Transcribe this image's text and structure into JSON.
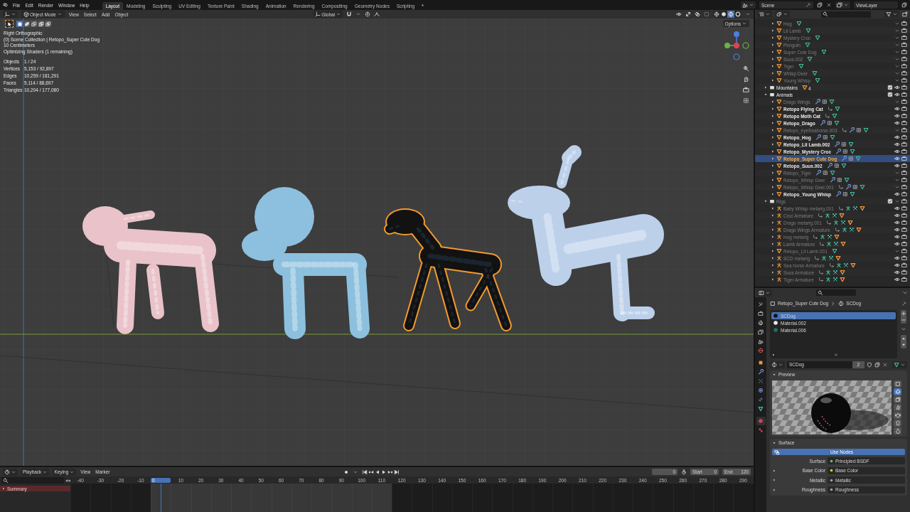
{
  "topbar": {
    "menus": [
      "File",
      "Edit",
      "Render",
      "Window",
      "Help"
    ],
    "workspaces": [
      {
        "label": "Layout",
        "selected": true
      },
      {
        "label": "Modeling",
        "selected": false
      },
      {
        "label": "Sculpting",
        "selected": false
      },
      {
        "label": "UV Editing",
        "selected": false
      },
      {
        "label": "Texture Paint",
        "selected": false
      },
      {
        "label": "Shading",
        "selected": false
      },
      {
        "label": "Animation",
        "selected": false
      },
      {
        "label": "Rendering",
        "selected": false
      },
      {
        "label": "Compositing",
        "selected": false
      },
      {
        "label": "Geometry Nodes",
        "selected": false
      },
      {
        "label": "Scripting",
        "selected": false
      }
    ],
    "add_workspace": "+",
    "scene": "Scene",
    "view_layer": "ViewLayer"
  },
  "viewport": {
    "mode": "Object Mode",
    "menus": [
      "View",
      "Select",
      "Add",
      "Object"
    ],
    "orientation": "Global",
    "shading": [
      {
        "kind": "wireframe",
        "selected": false
      },
      {
        "kind": "solid",
        "selected": false
      },
      {
        "kind": "material",
        "selected": true
      },
      {
        "kind": "rendered",
        "selected": false
      }
    ],
    "select_modes": [
      {
        "kind": "set",
        "selected": true
      },
      {
        "kind": "extend",
        "selected": false
      },
      {
        "kind": "subtract",
        "selected": false
      },
      {
        "kind": "difference",
        "selected": false
      },
      {
        "kind": "intersect",
        "selected": false
      }
    ],
    "options": "Options",
    "info": [
      "Right Orthographic",
      "(0) Scene Collection | Retopo_Super Cute Dog",
      "10 Centimeters",
      "Optimizing Shaders (1 remaining)"
    ],
    "stats": [
      {
        "label": "Objects",
        "value": "1 / 24"
      },
      {
        "label": "Vertices",
        "value": "5,153 / 92,897"
      },
      {
        "label": "Edges",
        "value": "10,259 / 181,291"
      },
      {
        "label": "Faces",
        "value": "5,114 / 88,697"
      },
      {
        "label": "Triangles",
        "value": "10,204 / 177,080"
      }
    ],
    "models": [
      {
        "kind": "lamb",
        "selected": false
      },
      {
        "kind": "deer",
        "selected": false
      },
      {
        "kind": "dog",
        "selected": true
      },
      {
        "kind": "seahorse",
        "selected": false
      }
    ]
  },
  "outliner": {
    "partial_items": [
      {
        "kind": "mesh-object",
        "name": "Hog",
        "visible": false,
        "selected": false,
        "expanded": false,
        "icons": [
          {
            "kind": "mesh"
          }
        ]
      },
      {
        "kind": "mesh-object",
        "name": "Lil Lamb",
        "visible": false,
        "selected": false,
        "expanded": false,
        "icons": [
          {
            "kind": "mesh"
          }
        ]
      },
      {
        "kind": "mesh-object",
        "name": "Mystery Croc",
        "visible": false,
        "selected": false,
        "expanded": false,
        "icons": [
          {
            "kind": "mesh"
          }
        ]
      },
      {
        "kind": "mesh-object",
        "name": "Penguin",
        "visible": false,
        "selected": false,
        "expanded": false,
        "icons": [
          {
            "kind": "mesh"
          }
        ]
      },
      {
        "kind": "mesh-object",
        "name": "Super Cute Dog",
        "visible": false,
        "selected": false,
        "expanded": false,
        "icons": [
          {
            "kind": "mesh"
          }
        ]
      },
      {
        "kind": "mesh-object",
        "name": "Suus.002",
        "visible": false,
        "selected": false,
        "expanded": false,
        "icons": [
          {
            "kind": "mesh"
          }
        ]
      },
      {
        "kind": "mesh-object",
        "name": "Tiger",
        "visible": false,
        "selected": false,
        "expanded": false,
        "icons": [
          {
            "kind": "mesh"
          }
        ]
      },
      {
        "kind": "mesh-object",
        "name": "Whisp Deer",
        "visible": false,
        "selected": false,
        "expanded": false,
        "icons": [
          {
            "kind": "mesh"
          }
        ]
      },
      {
        "kind": "mesh-object",
        "name": "Young Whisp",
        "visible": false,
        "selected": false,
        "expanded": false,
        "icons": [
          {
            "kind": "mesh"
          }
        ]
      }
    ],
    "items": [
      {
        "kind": "collection",
        "name": "Mountains",
        "visible": true,
        "checked": true,
        "selected": false,
        "expanded": false,
        "icons": [
          {
            "kind": "mesh-object"
          }
        ],
        "count": "4"
      },
      {
        "kind": "collection",
        "name": "Animals",
        "visible": true,
        "checked": true,
        "selected": false,
        "expanded": true,
        "children": [
          {
            "kind": "mesh-object",
            "name": "Drago Wings",
            "visible": false,
            "selected": false,
            "expanded": false,
            "icons": [
              {
                "kind": "wrench"
              },
              {
                "kind": "grid"
              },
              {
                "kind": "mesh"
              }
            ]
          },
          {
            "kind": "mesh-object",
            "name": "Retopo Flying Cat",
            "visible": true,
            "selected": false,
            "expanded": false,
            "icons": [
              {
                "kind": "hook"
              },
              {
                "kind": "mesh"
              }
            ]
          },
          {
            "kind": "mesh-object",
            "name": "Retopo Moth Cat",
            "visible": true,
            "selected": false,
            "expanded": false,
            "icons": [
              {
                "kind": "hook"
              },
              {
                "kind": "mesh"
              }
            ]
          },
          {
            "kind": "mesh-object",
            "name": "Retopo_Drago",
            "visible": true,
            "selected": false,
            "expanded": false,
            "icons": [
              {
                "kind": "wrench"
              },
              {
                "kind": "grid"
              },
              {
                "kind": "mesh"
              }
            ]
          },
          {
            "kind": "mesh-object",
            "name": "Retopo_eyeSeahorse.003",
            "visible": false,
            "selected": false,
            "expanded": false,
            "icons": [
              {
                "kind": "hook"
              },
              {
                "kind": "wrench"
              },
              {
                "kind": "grid"
              },
              {
                "kind": "mesh"
              }
            ]
          },
          {
            "kind": "mesh-object",
            "name": "Retopo_Hog",
            "visible": true,
            "selected": false,
            "expanded": false,
            "icons": [
              {
                "kind": "wrench"
              },
              {
                "kind": "grid"
              },
              {
                "kind": "mesh"
              }
            ]
          },
          {
            "kind": "mesh-object",
            "name": "Retopo_Lil Lamb.002",
            "visible": true,
            "selected": false,
            "expanded": false,
            "icons": [
              {
                "kind": "wrench"
              },
              {
                "kind": "grid"
              },
              {
                "kind": "mesh"
              }
            ]
          },
          {
            "kind": "mesh-object",
            "name": "Retopo_Mystery Croc",
            "visible": true,
            "selected": false,
            "expanded": false,
            "icons": [
              {
                "kind": "wrench"
              },
              {
                "kind": "grid"
              },
              {
                "kind": "mesh"
              }
            ]
          },
          {
            "kind": "mesh-object",
            "name": "Retopo_Super Cute Dog",
            "visible": true,
            "selected": true,
            "expanded": false,
            "icons": [
              {
                "kind": "wrench"
              },
              {
                "kind": "grid"
              },
              {
                "kind": "mesh"
              }
            ]
          },
          {
            "kind": "mesh-object",
            "name": "Retopo_Suus.002",
            "visible": true,
            "selected": false,
            "expanded": false,
            "icons": [
              {
                "kind": "wrench"
              },
              {
                "kind": "grid"
              },
              {
                "kind": "mesh"
              }
            ]
          },
          {
            "kind": "mesh-object",
            "name": "Retopo_Tiger",
            "visible": false,
            "selected": false,
            "expanded": false,
            "icons": [
              {
                "kind": "wrench"
              },
              {
                "kind": "grid"
              },
              {
                "kind": "mesh"
              }
            ]
          },
          {
            "kind": "mesh-object",
            "name": "Retopo_Whisp Deer",
            "visible": false,
            "selected": false,
            "expanded": false,
            "icons": [
              {
                "kind": "wrench"
              },
              {
                "kind": "grid"
              },
              {
                "kind": "mesh"
              }
            ]
          },
          {
            "kind": "mesh-object",
            "name": "Retopo_Whisp Deer.001",
            "visible": false,
            "selected": false,
            "expanded": false,
            "icons": [
              {
                "kind": "hook"
              },
              {
                "kind": "wrench"
              },
              {
                "kind": "grid"
              },
              {
                "kind": "mesh"
              }
            ]
          },
          {
            "kind": "mesh-object",
            "name": "Retopo_Young Whisp",
            "visible": true,
            "selected": false,
            "expanded": false,
            "icons": [
              {
                "kind": "wrench"
              },
              {
                "kind": "grid"
              },
              {
                "kind": "mesh"
              }
            ]
          }
        ]
      },
      {
        "kind": "collection",
        "name": "Rigs",
        "visible": false,
        "checked": true,
        "selected": false,
        "expanded": true,
        "children": [
          {
            "kind": "armature-object",
            "name": "Baby Whisp metarig.001",
            "visible": true,
            "selected": false,
            "expanded": false,
            "icons": [
              {
                "kind": "hook"
              },
              {
                "kind": "armature-data"
              },
              {
                "kind": "pose"
              },
              {
                "kind": "mesh-object"
              }
            ]
          },
          {
            "kind": "armature-object",
            "name": "Croc Armature",
            "visible": true,
            "selected": false,
            "expanded": false,
            "icons": [
              {
                "kind": "hook"
              },
              {
                "kind": "armature-data"
              },
              {
                "kind": "pose"
              },
              {
                "kind": "mesh-object"
              }
            ]
          },
          {
            "kind": "armature-object",
            "name": "Drago metarig.001",
            "visible": true,
            "selected": false,
            "expanded": false,
            "icons": [
              {
                "kind": "hook"
              },
              {
                "kind": "armature-data"
              },
              {
                "kind": "pose"
              },
              {
                "kind": "mesh-object"
              }
            ]
          },
          {
            "kind": "armature-object",
            "name": "Drago Wings Armature",
            "visible": true,
            "selected": false,
            "expanded": false,
            "icons": [
              {
                "kind": "hook"
              },
              {
                "kind": "armature-data"
              },
              {
                "kind": "pose"
              },
              {
                "kind": "mesh-object"
              }
            ]
          },
          {
            "kind": "armature-object",
            "name": "Hog metarig",
            "visible": true,
            "selected": false,
            "expanded": false,
            "icons": [
              {
                "kind": "hook"
              },
              {
                "kind": "armature-data"
              },
              {
                "kind": "pose"
              },
              {
                "kind": "mesh-object"
              }
            ]
          },
          {
            "kind": "armature-object",
            "name": "Lamb Armature",
            "visible": true,
            "selected": false,
            "expanded": false,
            "icons": [
              {
                "kind": "hook"
              },
              {
                "kind": "armature-data"
              },
              {
                "kind": "pose"
              },
              {
                "kind": "mesh-object"
              }
            ]
          },
          {
            "kind": "mesh-object",
            "name": "Retopo_Lil Lamb.001",
            "visible": false,
            "selected": false,
            "expanded": false,
            "icons": [
              {
                "kind": "mesh"
              }
            ]
          },
          {
            "kind": "armature-object",
            "name": "SCD metarig",
            "visible": true,
            "selected": false,
            "expanded": false,
            "icons": [
              {
                "kind": "hook"
              },
              {
                "kind": "armature-data"
              },
              {
                "kind": "pose"
              },
              {
                "kind": "mesh-object"
              }
            ]
          },
          {
            "kind": "armature-object",
            "name": "Sea horse Armature",
            "visible": true,
            "selected": false,
            "expanded": false,
            "icons": [
              {
                "kind": "hook"
              },
              {
                "kind": "armature-data"
              },
              {
                "kind": "pose"
              },
              {
                "kind": "mesh-object"
              }
            ]
          },
          {
            "kind": "armature-object",
            "name": "Suus Armature",
            "visible": true,
            "selected": false,
            "expanded": false,
            "icons": [
              {
                "kind": "hook"
              },
              {
                "kind": "armature-data"
              },
              {
                "kind": "pose"
              },
              {
                "kind": "mesh-object"
              }
            ]
          },
          {
            "kind": "armature-object",
            "name": "Tiger Armature",
            "visible": true,
            "selected": false,
            "expanded": false,
            "icons": [
              {
                "kind": "hook"
              },
              {
                "kind": "armature-data"
              },
              {
                "kind": "pose"
              },
              {
                "kind": "mesh-object"
              }
            ]
          }
        ]
      }
    ]
  },
  "properties": {
    "tabs": [
      {
        "kind": "tool",
        "selected": false
      },
      {
        "kind": "render",
        "selected": false
      },
      {
        "kind": "output",
        "selected": false
      },
      {
        "kind": "view-layer",
        "selected": false
      },
      {
        "kind": "scene",
        "selected": false
      },
      {
        "kind": "world",
        "selected": false
      },
      {
        "kind": "object",
        "selected": false
      },
      {
        "kind": "modifiers",
        "selected": false
      },
      {
        "kind": "particles",
        "selected": false
      },
      {
        "kind": "physics",
        "selected": false
      },
      {
        "kind": "constraints",
        "selected": false
      },
      {
        "kind": "data",
        "selected": false
      },
      {
        "kind": "material",
        "selected": true
      },
      {
        "kind": "texture",
        "selected": false
      }
    ],
    "object": "Retopo_Super Cute Dog",
    "material": "SCDog",
    "slots": [
      {
        "name": "SCDog",
        "selected": true,
        "color": "#101010"
      },
      {
        "name": "Material.002",
        "selected": false,
        "color": "#e8e8e8"
      },
      {
        "name": "Material.006",
        "selected": false,
        "color": "#1f6f6a"
      }
    ],
    "material_field": {
      "name": "SCDog",
      "users": "2"
    },
    "preview": {
      "title": "Preview",
      "expanded": true,
      "shapes": [
        {
          "kind": "plane",
          "selected": false
        },
        {
          "kind": "sphere",
          "selected": true
        },
        {
          "kind": "cube",
          "selected": false
        },
        {
          "kind": "hair",
          "selected": false
        },
        {
          "kind": "monkey",
          "selected": false
        },
        {
          "kind": "cloth",
          "selected": false
        },
        {
          "kind": "fluid",
          "selected": false
        }
      ]
    },
    "surface": {
      "title": "Surface",
      "expanded": true,
      "use_nodes": "Use Nodes",
      "rows": [
        {
          "label": "Surface",
          "value": "Principled BSDF",
          "color": "#5ccc5c",
          "expandable": false
        },
        {
          "label": "Base Color",
          "value": "Base Color",
          "color": "#e8d21a",
          "expandable": true
        },
        {
          "label": "Metallic",
          "value": "Metallic",
          "color": "#a1a1a1",
          "expandable": true
        },
        {
          "label": "Roughness",
          "value": "Roughness",
          "color": "#a1a1a1",
          "expandable": true
        }
      ]
    }
  },
  "timeline": {
    "menus": [
      {
        "label": "Playback",
        "dropdown": true
      },
      {
        "label": "Keying",
        "dropdown": true
      },
      {
        "label": "View",
        "dropdown": false
      },
      {
        "label": "Marker",
        "dropdown": false
      }
    ],
    "current_frame": "0",
    "start": {
      "label": "Start",
      "value": "0"
    },
    "end": {
      "label": "End",
      "value": "120"
    },
    "channels": [
      {
        "name": "Summary",
        "expanded": false
      }
    ],
    "ruler": [
      {
        "label": "-40",
        "in_range": false,
        "selected": false
      },
      {
        "label": "-30",
        "in_range": false,
        "selected": false
      },
      {
        "label": "-20",
        "in_range": false,
        "selected": false
      },
      {
        "label": "-10",
        "in_range": false,
        "selected": false
      },
      {
        "label": "0",
        "in_range": true,
        "selected": true
      },
      {
        "label": "10",
        "in_range": true,
        "selected": false
      },
      {
        "label": "20",
        "in_range": true,
        "selected": false
      },
      {
        "label": "30",
        "in_range": true,
        "selected": false
      },
      {
        "label": "40",
        "in_range": true,
        "selected": false
      },
      {
        "label": "50",
        "in_range": true,
        "selected": false
      },
      {
        "label": "60",
        "in_range": true,
        "selected": false
      },
      {
        "label": "70",
        "in_range": true,
        "selected": false
      },
      {
        "label": "80",
        "in_range": true,
        "selected": false
      },
      {
        "label": "90",
        "in_range": true,
        "selected": false
      },
      {
        "label": "100",
        "in_range": true,
        "selected": false
      },
      {
        "label": "110",
        "in_range": true,
        "selected": false
      },
      {
        "label": "120",
        "in_range": false,
        "selected": false
      },
      {
        "label": "130",
        "in_range": false,
        "selected": false
      },
      {
        "label": "140",
        "in_range": false,
        "selected": false
      },
      {
        "label": "150",
        "in_range": false,
        "selected": false
      },
      {
        "label": "160",
        "in_range": false,
        "selected": false
      },
      {
        "label": "170",
        "in_range": false,
        "selected": false
      },
      {
        "label": "180",
        "in_range": false,
        "selected": false
      },
      {
        "label": "190",
        "in_range": false,
        "selected": false
      },
      {
        "label": "200",
        "in_range": false,
        "selected": false
      },
      {
        "label": "210",
        "in_range": false,
        "selected": false
      },
      {
        "label": "220",
        "in_range": false,
        "selected": false
      },
      {
        "label": "230",
        "in_range": false,
        "selected": false
      },
      {
        "label": "240",
        "in_range": false,
        "selected": false
      },
      {
        "label": "250",
        "in_range": false,
        "selected": false
      },
      {
        "label": "260",
        "in_range": false,
        "selected": false
      },
      {
        "label": "270",
        "in_range": false,
        "selected": false
      },
      {
        "label": "280",
        "in_range": false,
        "selected": false
      },
      {
        "label": "290",
        "in_range": false,
        "selected": false
      }
    ]
  }
}
